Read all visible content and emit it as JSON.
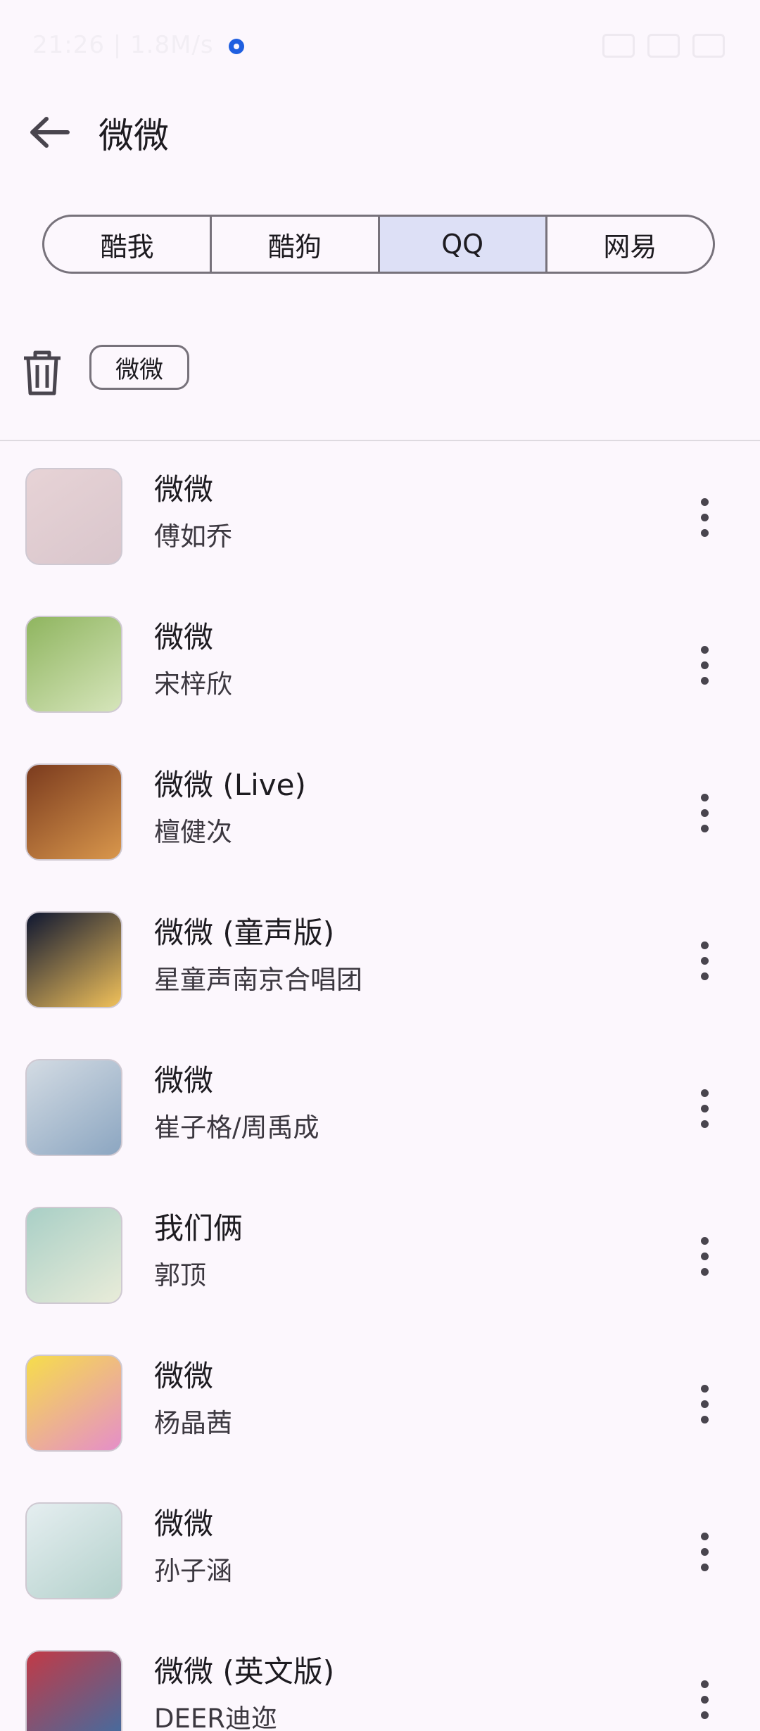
{
  "status_bar": {
    "left_text": "21:26 | 1.8M/s"
  },
  "app_bar": {
    "back_icon": "arrow-left-icon",
    "title": "微微"
  },
  "sources": {
    "tabs": [
      {
        "label": "酷我"
      },
      {
        "label": "酷狗"
      },
      {
        "label": "QQ"
      },
      {
        "label": "网易"
      }
    ],
    "selected": "QQ",
    "selected_color": "#dde0f6"
  },
  "history": {
    "delete_icon": "trash-icon",
    "chips": [
      {
        "label": "微微"
      }
    ]
  },
  "songs": [
    {
      "title": "微微",
      "artist": "傅如乔",
      "cover_colors": [
        "#e7d3d6",
        "#d9c6cc"
      ]
    },
    {
      "title": "微微",
      "artist": "宋梓欣",
      "cover_colors": [
        "#8fb55f",
        "#d6e5bb"
      ]
    },
    {
      "title": "微微 (Live)",
      "artist": "檀健次",
      "cover_colors": [
        "#7b3b1e",
        "#d9974c"
      ]
    },
    {
      "title": "微微 (童声版)",
      "artist": "星童声南京合唱团",
      "cover_colors": [
        "#0e1631",
        "#f1c15a"
      ]
    },
    {
      "title": "微微",
      "artist": "崔子格/周禹成",
      "cover_colors": [
        "#d3dbe3",
        "#8ca6c1"
      ]
    },
    {
      "title": "我们俩",
      "artist": "郭顶",
      "cover_colors": [
        "#a9cfc6",
        "#e9ecd9"
      ]
    },
    {
      "title": "微微",
      "artist": "杨晶茜",
      "cover_colors": [
        "#f6dd4b",
        "#e58ec9"
      ]
    },
    {
      "title": "微微",
      "artist": "孙子涵",
      "cover_colors": [
        "#e5eef0",
        "#b4d1cc"
      ]
    },
    {
      "title": "微微 (英文版)",
      "artist": "DEER迪迩",
      "cover_colors": [
        "#c23a46",
        "#3c6fa5"
      ]
    }
  ],
  "more_icon": "more-vertical-icon"
}
